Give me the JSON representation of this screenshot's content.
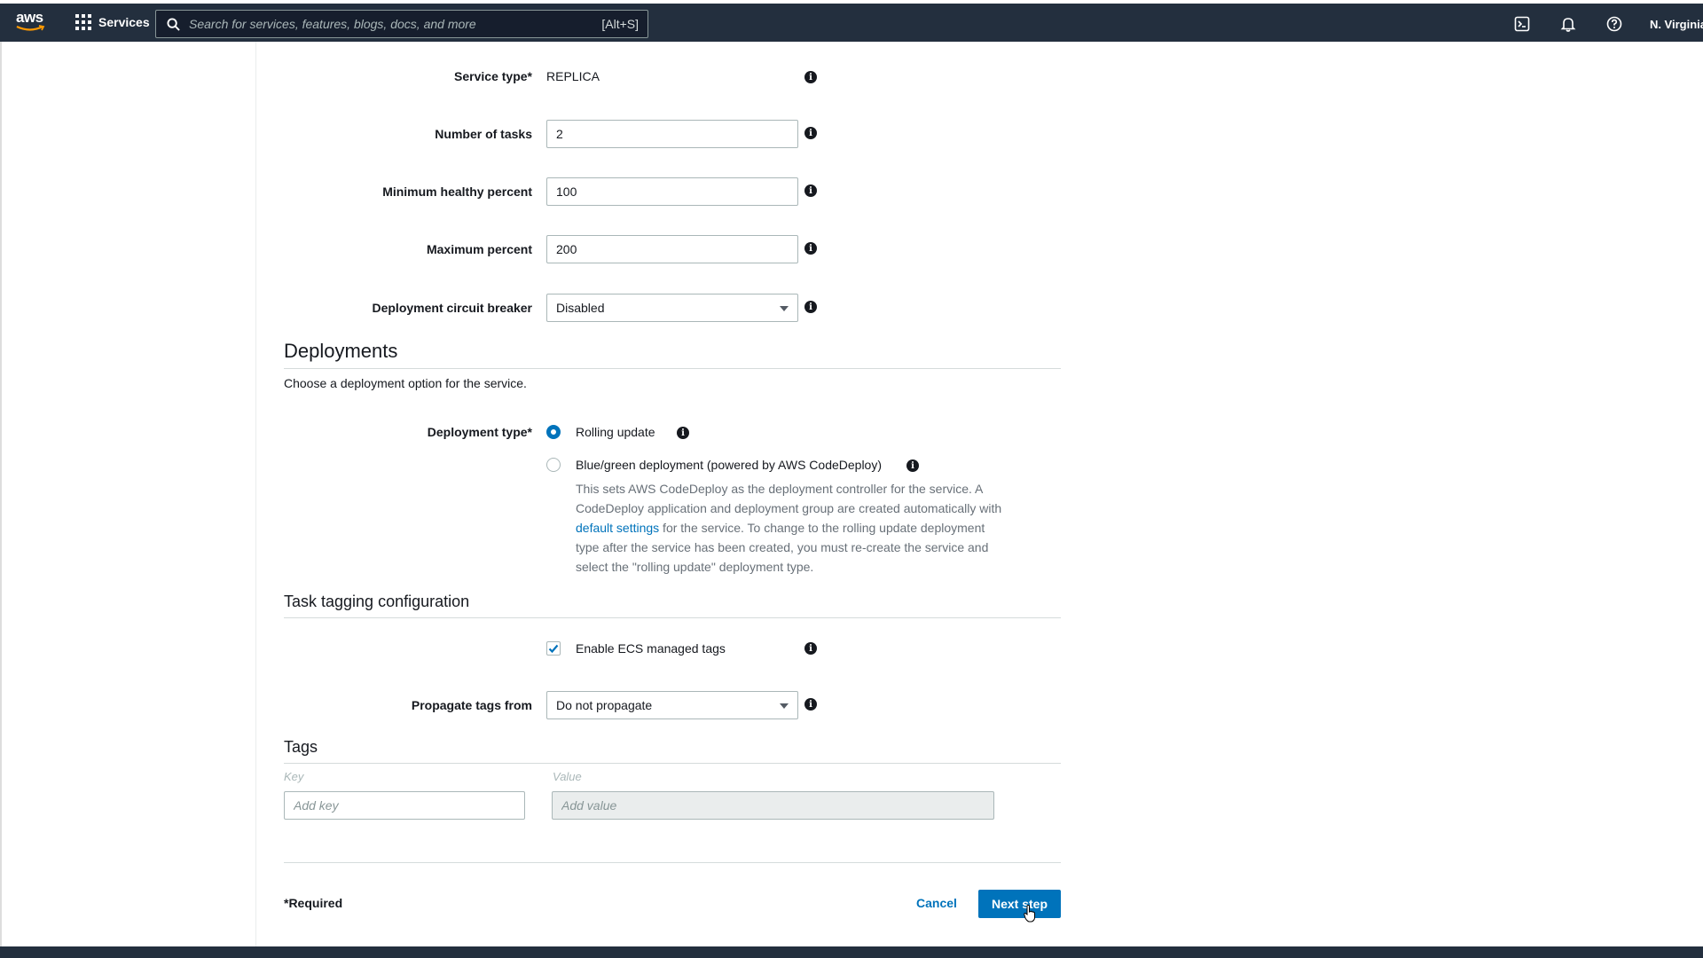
{
  "topbar": {
    "logo_text": "aws",
    "services_label": "Services",
    "search_placeholder": "Search for services, features, blogs, docs, and more",
    "search_shortcut": "[Alt+S]",
    "region": "N. Virginia"
  },
  "service": {
    "service_type_label": "Service type*",
    "service_type_value": "REPLICA",
    "number_of_tasks_label": "Number of tasks",
    "number_of_tasks_value": "2",
    "min_healthy_label": "Minimum healthy percent",
    "min_healthy_value": "100",
    "max_percent_label": "Maximum percent",
    "max_percent_value": "200",
    "circuit_breaker_label": "Deployment circuit breaker",
    "circuit_breaker_value": "Disabled"
  },
  "deployments": {
    "title": "Deployments",
    "description": "Choose a deployment option for the service.",
    "type_label": "Deployment type*",
    "rolling_label": "Rolling update",
    "bluegreen_label": "Blue/green deployment (powered by AWS CodeDeploy)",
    "help_before": "This sets AWS CodeDeploy as the deployment controller for the service. A CodeDeploy application and deployment group are created automatically with ",
    "help_link": "default settings",
    "help_after": " for the service. To change to the rolling update deployment type after the service has been created, you must re-create the service and select the \"rolling update\" deployment type.",
    "selected": "rolling"
  },
  "task_tagging": {
    "title": "Task tagging configuration",
    "enable_ecs_tags_label": "Enable ECS managed tags",
    "enable_ecs_tags_checked": true,
    "propagate_label": "Propagate tags from",
    "propagate_value": "Do not propagate"
  },
  "tags": {
    "title": "Tags",
    "key_header": "Key",
    "value_header": "Value",
    "key_placeholder": "Add key",
    "value_placeholder": "Add value"
  },
  "footer": {
    "required_note": "*Required",
    "cancel_label": "Cancel",
    "next_label": "Next step"
  },
  "colors": {
    "nav_bg": "#232f3e",
    "primary": "#0073bb"
  }
}
